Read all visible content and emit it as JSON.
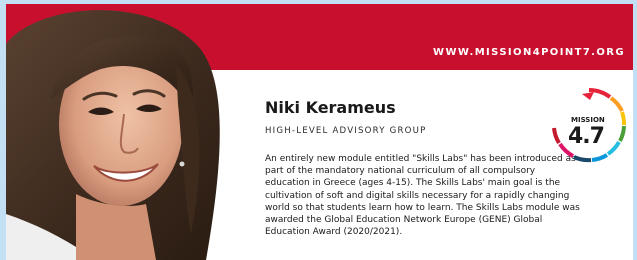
{
  "banner": {
    "url": "WWW.MISSION4POINT7.ORG"
  },
  "profile": {
    "name": "Niki Kerameus",
    "role": "HIGH-LEVEL ADVISORY GROUP",
    "bio": "An entirely new module entitled \"Skills Labs\" has been introduced as part of the mandatory national curriculum of all compulsory education in Greece (ages 4-15). The Skills Labs' main goal is the cultivation of soft and digital skills necessary for a rapidly changing world so that students learn how to learn. The Skills Labs module was awarded the Global Education Network Europe (GENE) Global Education Award (2020/2021)."
  },
  "logo": {
    "caption": "MISSION",
    "number": "4.7"
  },
  "colors": {
    "background": "#c3dff3",
    "banner_red": "#c8102e",
    "card": "#ffffff",
    "text": "#1a1a1a"
  }
}
